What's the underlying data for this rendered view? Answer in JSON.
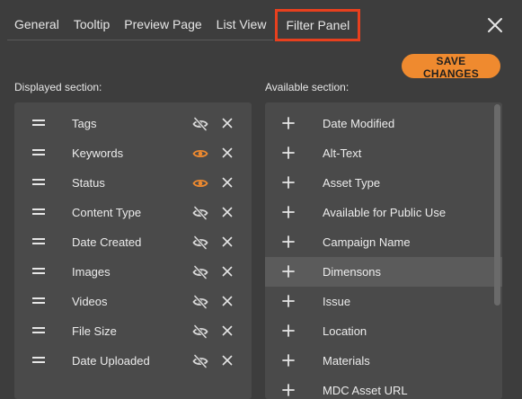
{
  "tabs": [
    {
      "label": "General"
    },
    {
      "label": "Tooltip"
    },
    {
      "label": "Preview Page"
    },
    {
      "label": "List View"
    },
    {
      "label": "Filter Panel"
    }
  ],
  "active_tab": "Filter Panel",
  "save_label": "SAVE CHANGES",
  "displayed": {
    "title": "Displayed section:",
    "items": [
      {
        "label": "Tags",
        "visible": false
      },
      {
        "label": "Keywords",
        "visible": true
      },
      {
        "label": "Status",
        "visible": true
      },
      {
        "label": "Content Type",
        "visible": false
      },
      {
        "label": "Date Created",
        "visible": false
      },
      {
        "label": "Images",
        "visible": false
      },
      {
        "label": "Videos",
        "visible": false
      },
      {
        "label": "File Size",
        "visible": false
      },
      {
        "label": "Date Uploaded",
        "visible": false
      }
    ]
  },
  "available": {
    "title": "Available section:",
    "items": [
      {
        "label": "Date Modified"
      },
      {
        "label": "Alt-Text"
      },
      {
        "label": "Asset Type"
      },
      {
        "label": "Available for Public Use"
      },
      {
        "label": "Campaign Name"
      },
      {
        "label": "Dimensons"
      },
      {
        "label": "Issue"
      },
      {
        "label": "Location"
      },
      {
        "label": "Materials"
      },
      {
        "label": "MDC Asset URL"
      }
    ],
    "hovered_item": "Dimensons"
  },
  "colors": {
    "accent": "#ef8a2f",
    "active_tab_border": "#e8401e",
    "eye_visible": "#ef8a2f",
    "eye_hidden": "#d8d8d8",
    "background": "#3d3d3d",
    "panel": "#4a4a4a"
  },
  "icons": {
    "close": "close-icon",
    "drag": "drag-handle-icon",
    "visible": "eye-icon",
    "hidden": "eye-off-icon",
    "remove": "remove-x-icon",
    "add": "plus-icon"
  }
}
